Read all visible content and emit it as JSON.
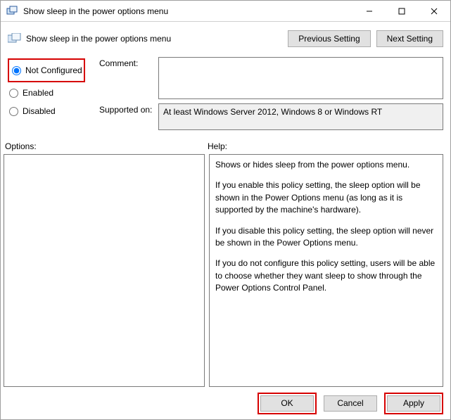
{
  "window": {
    "title": "Show sleep in the power options menu"
  },
  "header": {
    "title": "Show sleep in the power options menu",
    "prev_label": "Previous Setting",
    "next_label": "Next Setting"
  },
  "radios": {
    "not_configured": "Not Configured",
    "enabled": "Enabled",
    "disabled": "Disabled",
    "selected": "not_configured"
  },
  "fields": {
    "comment_label": "Comment:",
    "comment_value": "",
    "supported_label": "Supported on:",
    "supported_value": "At least Windows Server 2012, Windows 8 or Windows RT"
  },
  "mid": {
    "options_label": "Options:",
    "help_label": "Help:"
  },
  "options_content": "",
  "help_paragraphs": [
    "Shows or hides sleep from the power options menu.",
    "If you enable this policy setting, the sleep option will be shown in the Power Options menu (as long as it is supported by the machine's hardware).",
    "If you disable this policy setting, the sleep option will never be shown in the Power Options menu.",
    "If you do not configure this policy setting, users will be able to choose whether they want sleep to show through the Power Options Control Panel."
  ],
  "footer": {
    "ok": "OK",
    "cancel": "Cancel",
    "apply": "Apply"
  }
}
